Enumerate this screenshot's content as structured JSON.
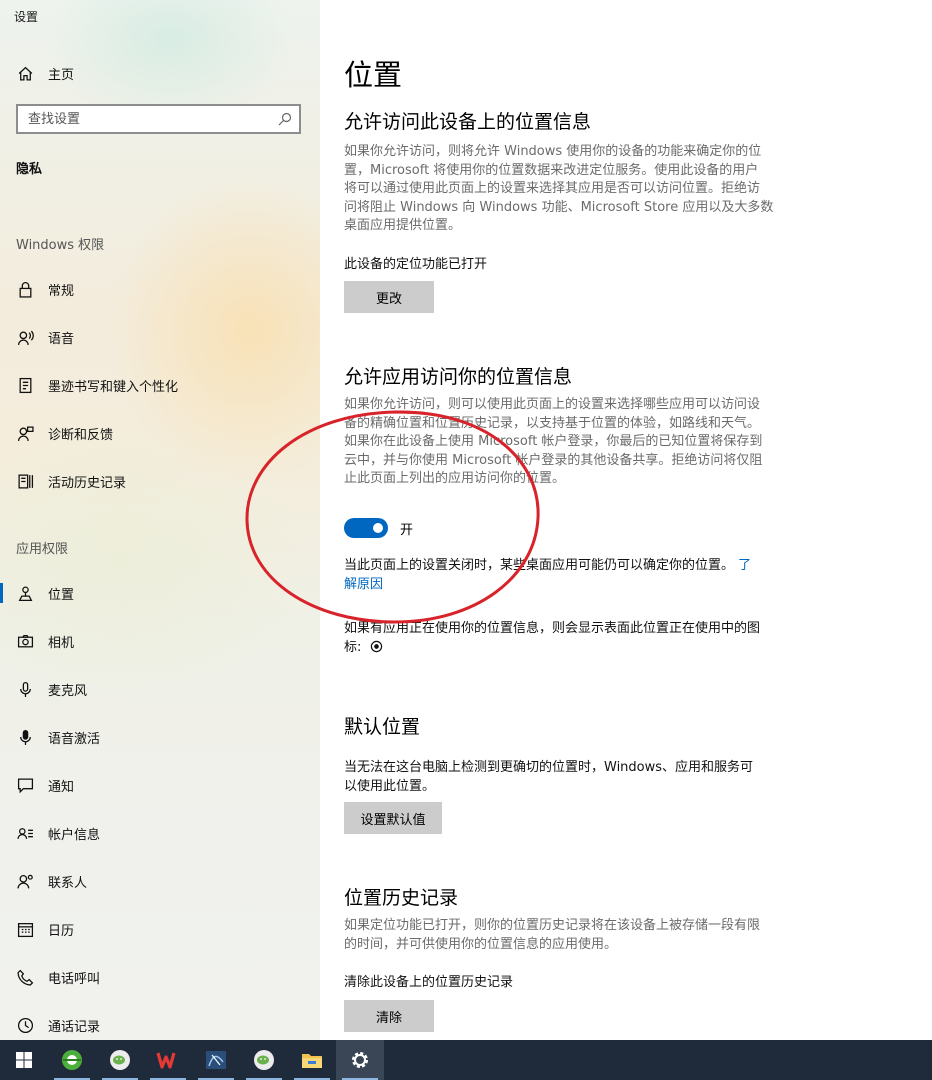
{
  "window": {
    "title": "设置"
  },
  "sidebar": {
    "home": {
      "label": "主页",
      "icon": "home-icon"
    },
    "search": {
      "placeholder": "查找设置",
      "icon": "search-icon"
    },
    "category_title": "隐私",
    "windows_permissions_header": "Windows 权限",
    "windows_items": [
      {
        "label": "常规",
        "icon": "lock-icon"
      },
      {
        "label": "语音",
        "icon": "speech-icon"
      },
      {
        "label": "墨迹书写和键入个性化",
        "icon": "inking-icon"
      },
      {
        "label": "诊断和反馈",
        "icon": "feedback-icon"
      },
      {
        "label": "活动历史记录",
        "icon": "activity-history-icon"
      }
    ],
    "app_permissions_header": "应用权限",
    "app_items": [
      {
        "label": "位置",
        "icon": "location-icon",
        "active": true
      },
      {
        "label": "相机",
        "icon": "camera-icon"
      },
      {
        "label": "麦克风",
        "icon": "microphone-icon"
      },
      {
        "label": "语音激活",
        "icon": "voice-activation-icon"
      },
      {
        "label": "通知",
        "icon": "notification-icon"
      },
      {
        "label": "帐户信息",
        "icon": "account-info-icon"
      },
      {
        "label": "联系人",
        "icon": "contacts-icon"
      },
      {
        "label": "日历",
        "icon": "calendar-icon"
      },
      {
        "label": "电话呼叫",
        "icon": "phone-icon"
      },
      {
        "label": "通话记录",
        "icon": "call-history-icon"
      }
    ]
  },
  "main": {
    "page_title": "位置",
    "device_section": {
      "heading": "允许访问此设备上的位置信息",
      "description_lines": [
        "如果你允许访问，则将允许 Windows 使用你的设备的功能来确定你的位",
        "置，Microsoft 将使用你的位置数据来改进定位服务。使用此设备的用户",
        "将可以通过使用此页面上的设置来选择其应用是否可以访问位置。拒绝访",
        "问将阻止 Windows 向 Windows 功能、Microsoft Store 应用以及大多数",
        "桌面应用提供位置。"
      ],
      "status": "此设备的定位功能已打开",
      "change_button": "更改"
    },
    "apps_section": {
      "heading": "允许应用访问你的位置信息",
      "description_lines": [
        "如果你允许访问，则可以使用此页面上的设置来选择哪些应用可以访问设",
        "备的精确位置和位置历史记录，以支持基于位置的体验，如路线和天气。",
        "如果你在此设备上使用 Microsoft 帐户登录，你最后的已知位置将保存到",
        "云中，并与你使用 Microsoft 帐户登录的其他设备共享。拒绝访问将仅阻",
        "止此页面上列出的应用访问你的位置。"
      ],
      "toggle_state": "开",
      "toggle_on": true,
      "note_line1": "当此页面上的设置关闭时，某些桌面应用可能仍可以确定你的位置。",
      "learn_more_part1": "了",
      "learn_more_part2": "解原因",
      "icon_note_line1": "如果有应用正在使用你的位置信息，则会显示表面此位置正在使用中的图",
      "icon_note_line2": "标:",
      "in_use_icon": "location-in-use-icon"
    },
    "default_section": {
      "heading": "默认位置",
      "text_line1": "当无法在这台电脑上检测到更确切的位置时，Windows、应用和服务可",
      "text_line2": "以使用此位置。",
      "button": "设置默认值"
    },
    "history_section": {
      "heading": "位置历史记录",
      "description_lines": [
        "如果定位功能已打开，则你的位置历史记录将在该设备上被存储一段有限",
        "的时间，并可供使用你的位置信息的应用使用。"
      ],
      "clear_label": "清除此设备上的位置历史记录",
      "clear_button": "清除"
    }
  },
  "taskbar": {
    "items": [
      {
        "icon": "windows-start-icon"
      },
      {
        "icon": "browser-icon"
      },
      {
        "icon": "wechat-icon"
      },
      {
        "icon": "wps-icon"
      },
      {
        "icon": "app-icon"
      },
      {
        "icon": "wechat-icon"
      },
      {
        "icon": "file-explorer-icon"
      },
      {
        "icon": "settings-gear-icon"
      }
    ]
  },
  "colors": {
    "accent": "#0067c0",
    "annotation": "#d8232a",
    "taskbar": "#1f2b3a",
    "button": "#cccccc"
  }
}
